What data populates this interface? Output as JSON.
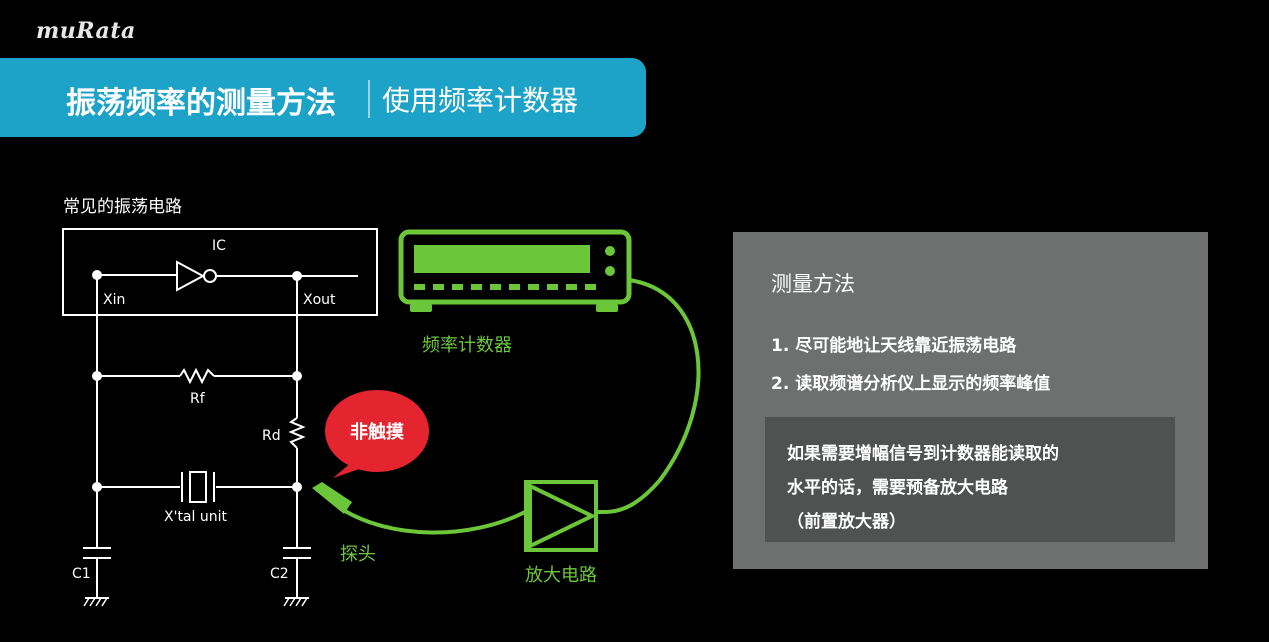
{
  "brand": {
    "logo_text": "muRata"
  },
  "header": {
    "title": "振荡频率的测量方法",
    "subtitle": "使用频率计数器"
  },
  "circuit": {
    "caption": "常见的振荡电路",
    "ic_label": "IC",
    "xin_label": "Xin",
    "xout_label": "Xout",
    "rf_label": "Rf",
    "rd_label": "Rd",
    "crystal_label": "X'tal unit",
    "c1_label": "C1",
    "c2_label": "C2"
  },
  "setup": {
    "counter_label": "频率计数器",
    "probe_label": "探头",
    "amp_label": "放大电路",
    "callout_text": "非触摸"
  },
  "panel": {
    "heading": "测量方法",
    "items": [
      "1. 尽可能地让天线靠近振荡电路",
      "2. 读取频谱分析仪上显示的频率峰值"
    ],
    "note_lines": [
      "如果需要增幅信号到计数器能读取的",
      "水平的话，需要预备放大电路",
      "（前置放大器）"
    ]
  },
  "colors": {
    "accent_blue": "#1ea3c8",
    "equipment_green": "#6cc63a",
    "callout_red": "#e4242e",
    "panel_gray": "#6d706f",
    "note_gray": "#4f5251",
    "circuit_white": "#ffffff"
  }
}
